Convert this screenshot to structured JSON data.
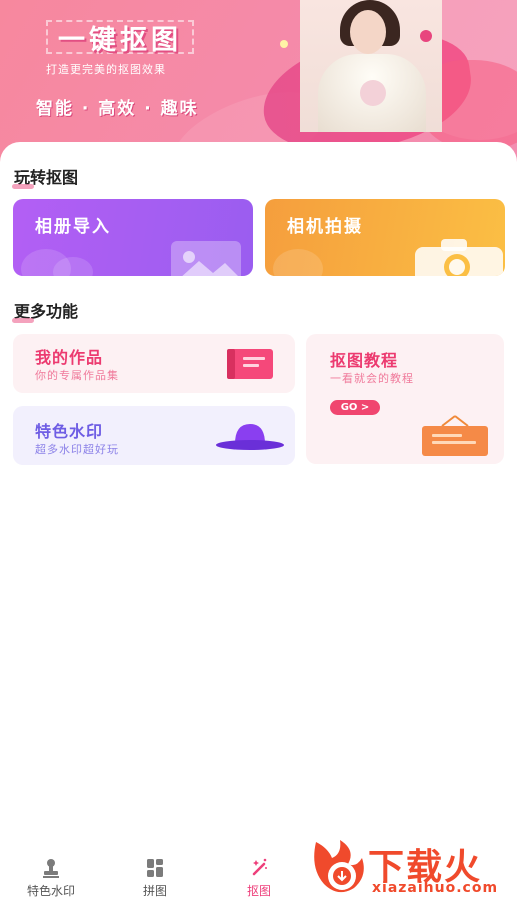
{
  "banner": {
    "title": "一键抠图",
    "subtitle": "打造更完美的抠图效果",
    "tagline": "智能 · 高效 · 趣味"
  },
  "sections": {
    "play": {
      "title": "玩转抠图"
    },
    "more": {
      "title": "更多功能"
    }
  },
  "actions": {
    "album_import": "相册导入",
    "camera_shoot": "相机拍摄"
  },
  "features": {
    "my_works": {
      "title": "我的作品",
      "subtitle": "你的专属作品集"
    },
    "watermark": {
      "title": "特色水印",
      "subtitle": "超多水印超好玩"
    },
    "tutorial": {
      "title": "抠图教程",
      "subtitle": "一看就会的教程",
      "go_label": "GO >"
    }
  },
  "bottom_nav": {
    "items": [
      {
        "label": "特色水印",
        "icon": "stamp-icon",
        "active": false
      },
      {
        "label": "拼图",
        "icon": "grid-icon",
        "active": false
      },
      {
        "label": "抠图",
        "icon": "magic-wand-icon",
        "active": true
      }
    ]
  },
  "watermark_logo": {
    "text": "下载火",
    "url": "xiazaihuo.com"
  },
  "colors": {
    "accent": "#ee3f7b",
    "album_card": "#a65ff2",
    "camera_card": "#f8ad40",
    "watermark_purple": "#6e5de4"
  }
}
